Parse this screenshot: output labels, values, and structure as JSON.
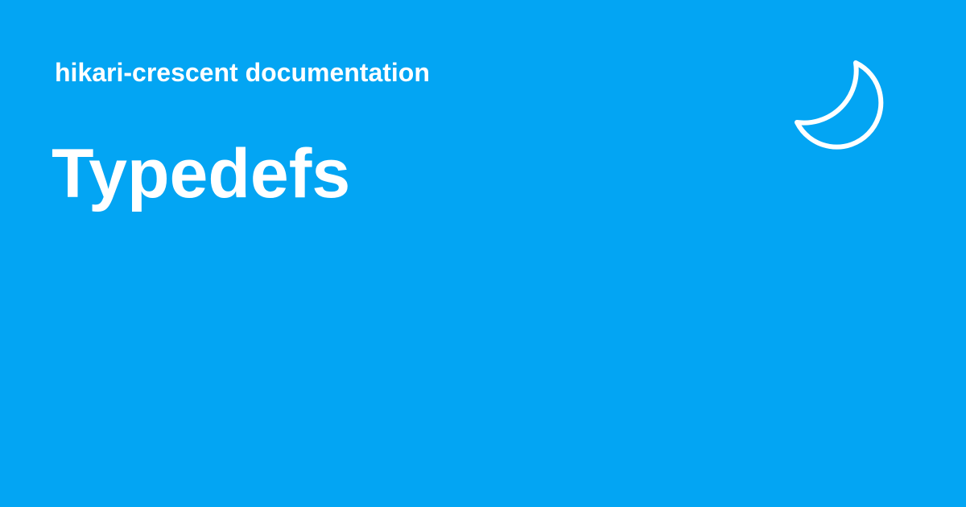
{
  "header": {
    "site_name": "hikari-crescent documentation",
    "logo_icon": "crescent-moon-icon"
  },
  "main": {
    "title": "Typedefs"
  },
  "colors": {
    "background": "#03a5f3",
    "foreground": "#ffffff"
  }
}
